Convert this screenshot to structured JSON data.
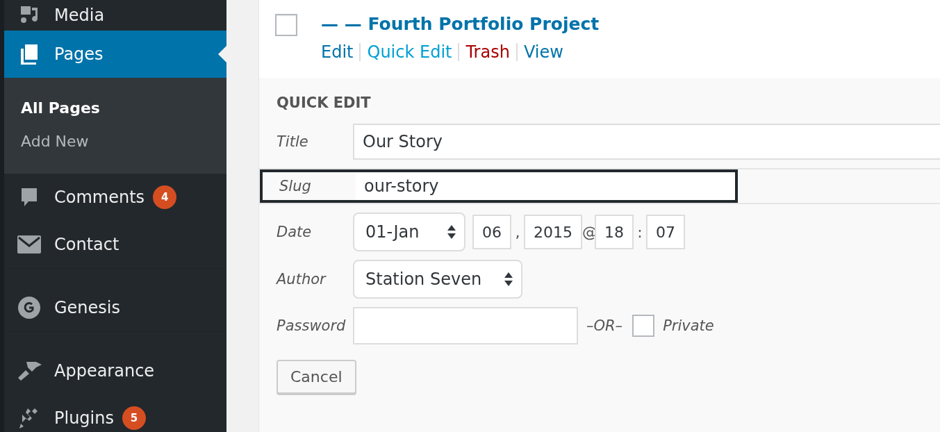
{
  "sidebar": {
    "items": [
      {
        "label": "Media",
        "kind": "media",
        "selected": false,
        "group_start": false
      },
      {
        "label": "Pages",
        "kind": "pages",
        "selected": true,
        "group_start": false,
        "children": [
          {
            "label": "All Pages",
            "selected": true
          },
          {
            "label": "Add New",
            "selected": false
          }
        ]
      },
      {
        "label": "Comments",
        "kind": "comments",
        "selected": false,
        "group_start": false,
        "badge": "4"
      },
      {
        "label": "Contact",
        "kind": "contact",
        "selected": false,
        "group_start": false
      },
      {
        "label": "Genesis",
        "kind": "genesis",
        "selected": false,
        "group_start": true
      },
      {
        "label": "Appearance",
        "kind": "appearance",
        "selected": false,
        "group_start": true
      },
      {
        "label": "Plugins",
        "kind": "plugins",
        "selected": false,
        "group_start": false,
        "badge": "5"
      }
    ]
  },
  "row": {
    "checked": false,
    "title": "— — Fourth Portfolio Project",
    "actions": [
      {
        "label": "Edit",
        "kind": "normal"
      },
      {
        "label": "Quick Edit",
        "kind": "active"
      },
      {
        "label": "Trash",
        "kind": "delete"
      },
      {
        "label": "View",
        "kind": "normal"
      }
    ]
  },
  "quick_edit": {
    "heading": "QUICK EDIT",
    "title": {
      "label": "Title",
      "value": "Our Story"
    },
    "slug": {
      "label": "Slug",
      "value": "our-story",
      "focused": true
    },
    "date": {
      "label": "Date",
      "month": "01-Jan",
      "day": "06",
      "sep1": ",",
      "year": "2015",
      "sep2": "@",
      "hour": "18",
      "sep3": ":",
      "minute": "07"
    },
    "author": {
      "label": "Author",
      "value": "Station Seven"
    },
    "password": {
      "label": "Password",
      "or": "–OR–",
      "private_checked": false,
      "private_label": "Private"
    },
    "cancel": "Cancel"
  }
}
